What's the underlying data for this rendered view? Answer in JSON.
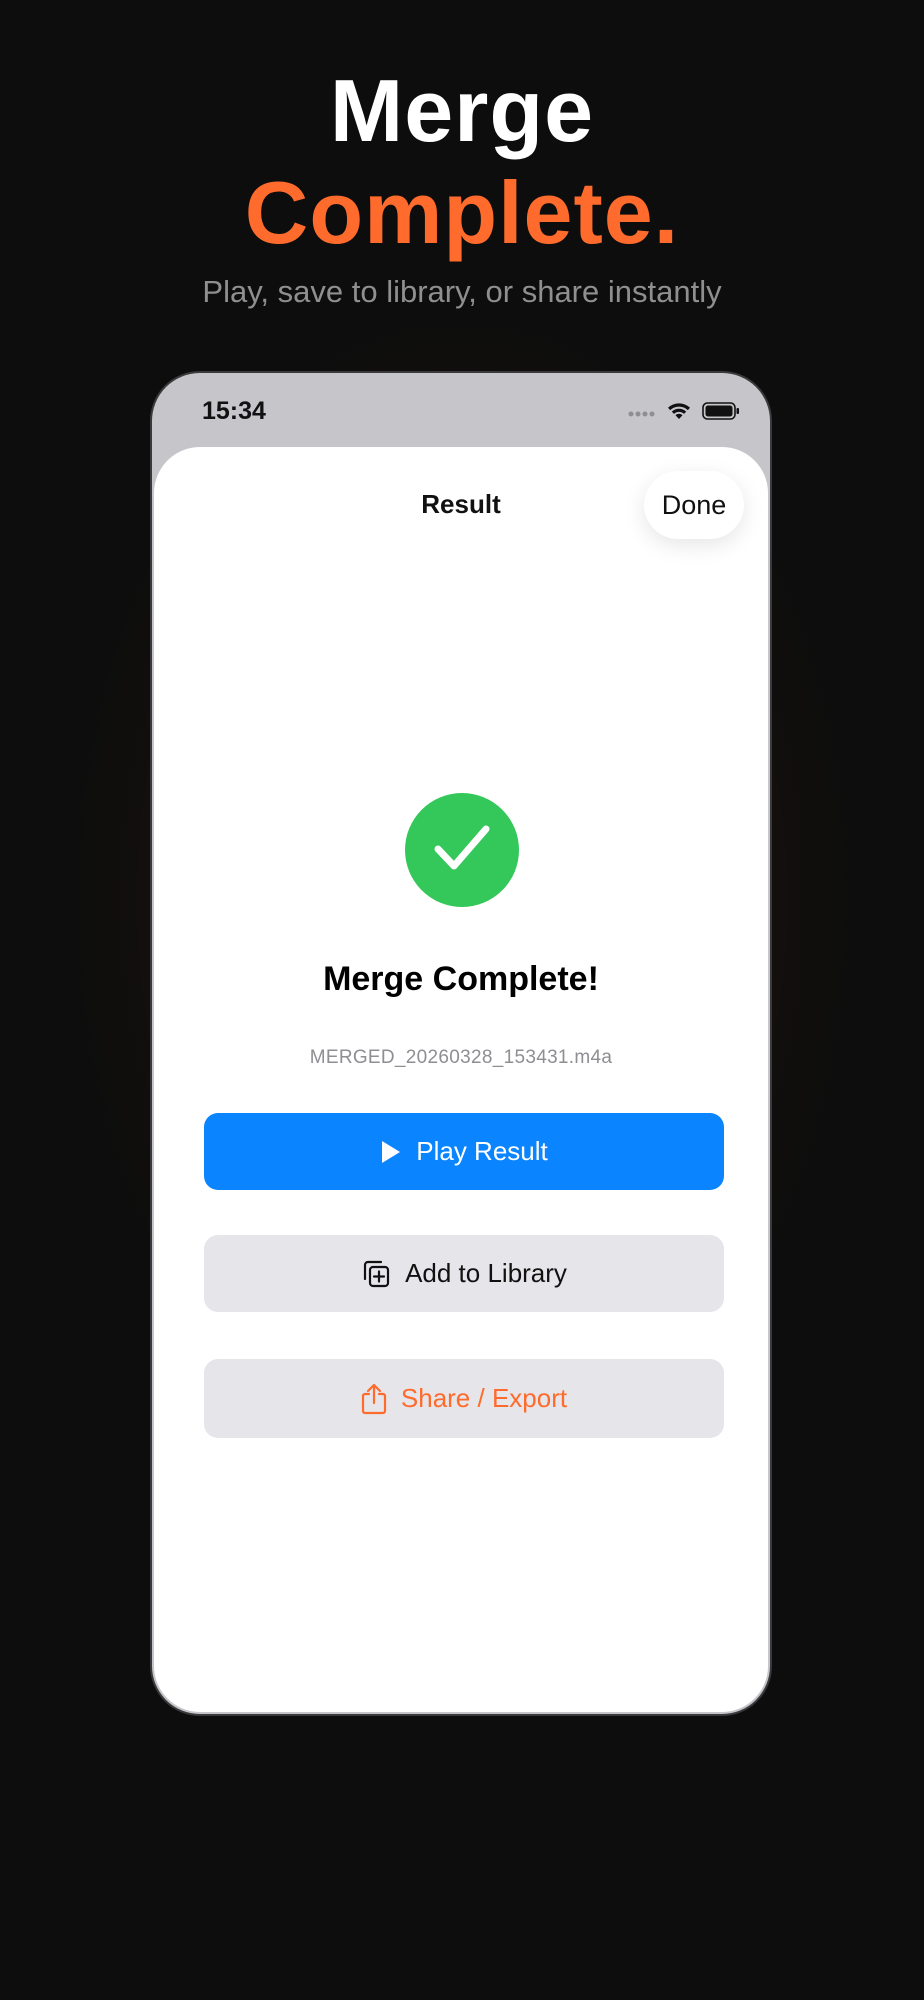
{
  "hero": {
    "title_line1": "Merge",
    "title_line2": "Complete.",
    "subtitle": "Play, save to library, or share instantly"
  },
  "status_bar": {
    "time": "15:34",
    "icons": [
      "signal-dots-icon",
      "wifi-icon",
      "battery-icon"
    ]
  },
  "nav": {
    "title": "Result",
    "done_label": "Done"
  },
  "result": {
    "icon": "checkmark-icon",
    "title": "Merge Complete!",
    "file_name": "MERGED_20260328_153431.m4a"
  },
  "actions": {
    "play_label": "Play Result",
    "library_label": "Add to Library",
    "share_label": "Share / Export"
  },
  "colors": {
    "background": "#0d0d0d",
    "accent_orange": "#ff6b2c",
    "primary_blue": "#0a84ff",
    "success_green": "#34c759",
    "secondary_button": "#e5e5ea"
  }
}
